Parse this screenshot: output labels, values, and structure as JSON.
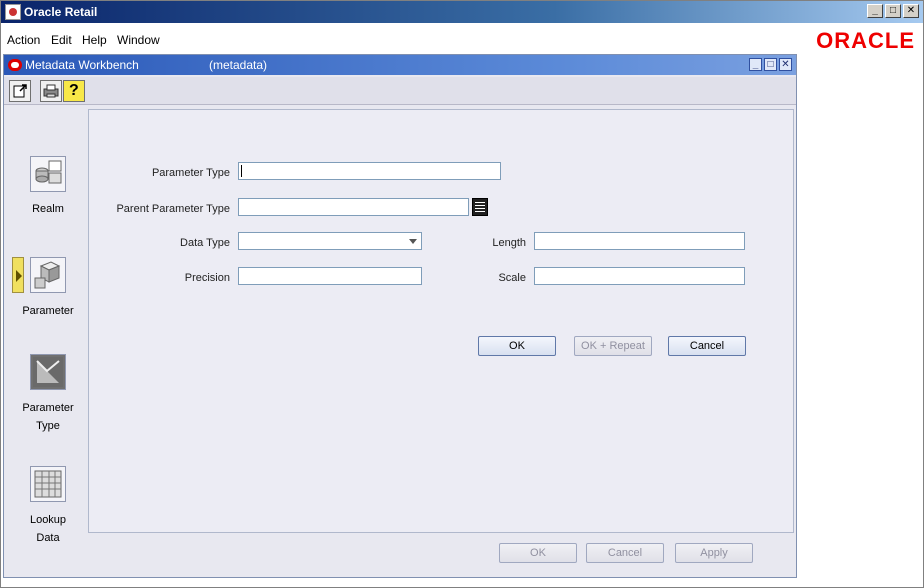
{
  "app": {
    "title": "Oracle Retail",
    "logo_text": "ORACLE",
    "window_controls": {
      "minimize": "_",
      "maximize": "□",
      "close": "✕"
    }
  },
  "menu": {
    "items": [
      {
        "label": "Action"
      },
      {
        "label": "Edit"
      },
      {
        "label": "Help"
      },
      {
        "label": "Window"
      }
    ]
  },
  "workbench": {
    "title": "Metadata Workbench",
    "context": "(metadata)",
    "toolbar": {
      "icons": [
        "exit-icon",
        "print-icon",
        "help-icon"
      ],
      "help_glyph": "?"
    }
  },
  "nav": {
    "items": [
      {
        "label_line1": "Realm",
        "label_line2": "",
        "icon": "realm-icon",
        "active": false
      },
      {
        "label_line1": "Parameter",
        "label_line2": "",
        "icon": "parameter-icon",
        "active": true
      },
      {
        "label_line1": "Parameter",
        "label_line2": "Type",
        "icon": "parameter-type-icon",
        "active": false
      },
      {
        "label_line1": "Lookup",
        "label_line2": "Data",
        "icon": "lookup-data-icon",
        "active": false
      }
    ]
  },
  "form": {
    "parameter_type": {
      "label": "Parameter Type",
      "value": ""
    },
    "parent_parameter_type": {
      "label": "Parent Parameter Type",
      "value": ""
    },
    "data_type": {
      "label": "Data Type",
      "value": ""
    },
    "length": {
      "label": "Length",
      "value": ""
    },
    "precision": {
      "label": "Precision",
      "value": ""
    },
    "scale": {
      "label": "Scale",
      "value": ""
    },
    "buttons": {
      "ok": "OK",
      "ok_repeat": "OK + Repeat",
      "cancel": "Cancel"
    }
  },
  "footer_buttons": {
    "ok": "OK",
    "cancel": "Cancel",
    "apply": "Apply"
  },
  "colors": {
    "accent": "#e00000",
    "title_bar": "#2a58b8",
    "panel": "#ececf4"
  }
}
